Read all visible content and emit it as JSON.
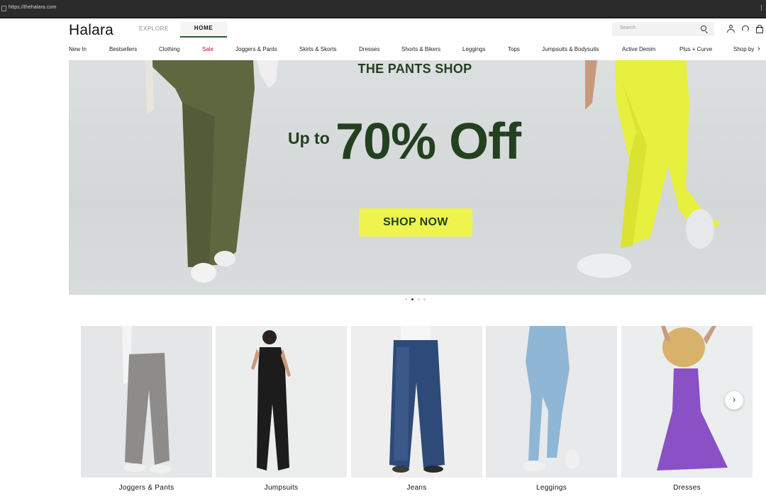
{
  "browser": {
    "url": "https://thehalara.com"
  },
  "header": {
    "logo": "Halara",
    "tabs": [
      {
        "label": "EXPLORE",
        "active": false
      },
      {
        "label": "HOME",
        "active": true
      }
    ],
    "search": {
      "placeholder": "Search"
    },
    "icons": [
      "user-icon",
      "headset-icon",
      "bag-icon"
    ]
  },
  "nav": {
    "items": [
      {
        "label": "New In"
      },
      {
        "label": "Bestsellers"
      },
      {
        "label": "Clothing"
      },
      {
        "label": "Sale",
        "highlight": "#c0102a"
      },
      {
        "label": "Joggers & Pants"
      },
      {
        "label": "Skirts & Skorts"
      },
      {
        "label": "Dresses"
      },
      {
        "label": "Shorts & Bikers"
      },
      {
        "label": "Leggings"
      },
      {
        "label": "Tops"
      },
      {
        "label": "Jumpsuits & Bodysuits"
      },
      {
        "label": "Active Denim"
      },
      {
        "label": "Plus + Curve"
      },
      {
        "label": "Shop by"
      }
    ],
    "more_icon": "chevron-right-icon"
  },
  "hero": {
    "kicker": "THE PANTS SHOP",
    "pretext": "Up to",
    "headline": "70% Off",
    "cta": "SHOP NOW",
    "colors": {
      "text": "#23401f",
      "button": "#eef44c"
    },
    "slides_total": 4,
    "active_slide": 2
  },
  "categories": {
    "items": [
      {
        "label": "Joggers & Pants"
      },
      {
        "label": "Jumpsuits"
      },
      {
        "label": "Jeans"
      },
      {
        "label": "Leggings"
      },
      {
        "label": "Dresses"
      }
    ],
    "next_icon": "chevron-right-icon"
  }
}
